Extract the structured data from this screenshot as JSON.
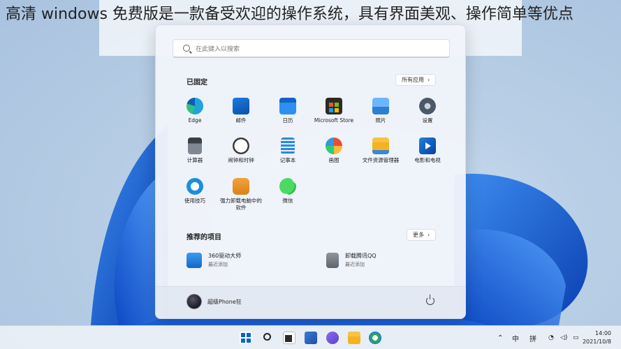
{
  "caption": "高清 windows 免费版是一款备受欢迎的操作系统，具有界面美观、操作简单等优点",
  "search": {
    "placeholder": "在此键入以搜索"
  },
  "pinned": {
    "title": "已固定",
    "all_apps_label": "所有应用",
    "apps": [
      {
        "label": "Edge",
        "icon": "edge-icon"
      },
      {
        "label": "邮件",
        "icon": "mail-icon"
      },
      {
        "label": "日历",
        "icon": "calendar-icon"
      },
      {
        "label": "Microsoft Store",
        "icon": "store-icon"
      },
      {
        "label": "照片",
        "icon": "photos-icon"
      },
      {
        "label": "设置",
        "icon": "gear-icon"
      },
      {
        "label": "计算器",
        "icon": "calculator-icon"
      },
      {
        "label": "闹钟和时钟",
        "icon": "clock-icon"
      },
      {
        "label": "记事本",
        "icon": "notepad-icon"
      },
      {
        "label": "画图",
        "icon": "paint-icon"
      },
      {
        "label": "文件资源管理器",
        "icon": "folder-icon"
      },
      {
        "label": "电影和电视",
        "icon": "movies-icon"
      },
      {
        "label": "使用技巧",
        "icon": "tips-icon"
      },
      {
        "label": "强力卸载电脑中的软件",
        "icon": "uninstall-icon"
      },
      {
        "label": "微信",
        "icon": "wechat-icon"
      }
    ]
  },
  "recommended": {
    "title": "推荐的项目",
    "more_label": "更多",
    "items": [
      {
        "name": "360驱动大师",
        "sub": "最近添加",
        "icon": "driver-icon"
      },
      {
        "name": "卸载腾讯QQ",
        "sub": "最近添加",
        "icon": "trash-icon"
      }
    ]
  },
  "user": {
    "name": "超级Phone狂"
  },
  "taskbar": {
    "ime_lang": "中",
    "ime_mode": "拼",
    "time": "14:00",
    "date": "2021/10/8"
  },
  "colors": {
    "accent": "#0a64c8",
    "start_bg": "#f0f4fa"
  }
}
